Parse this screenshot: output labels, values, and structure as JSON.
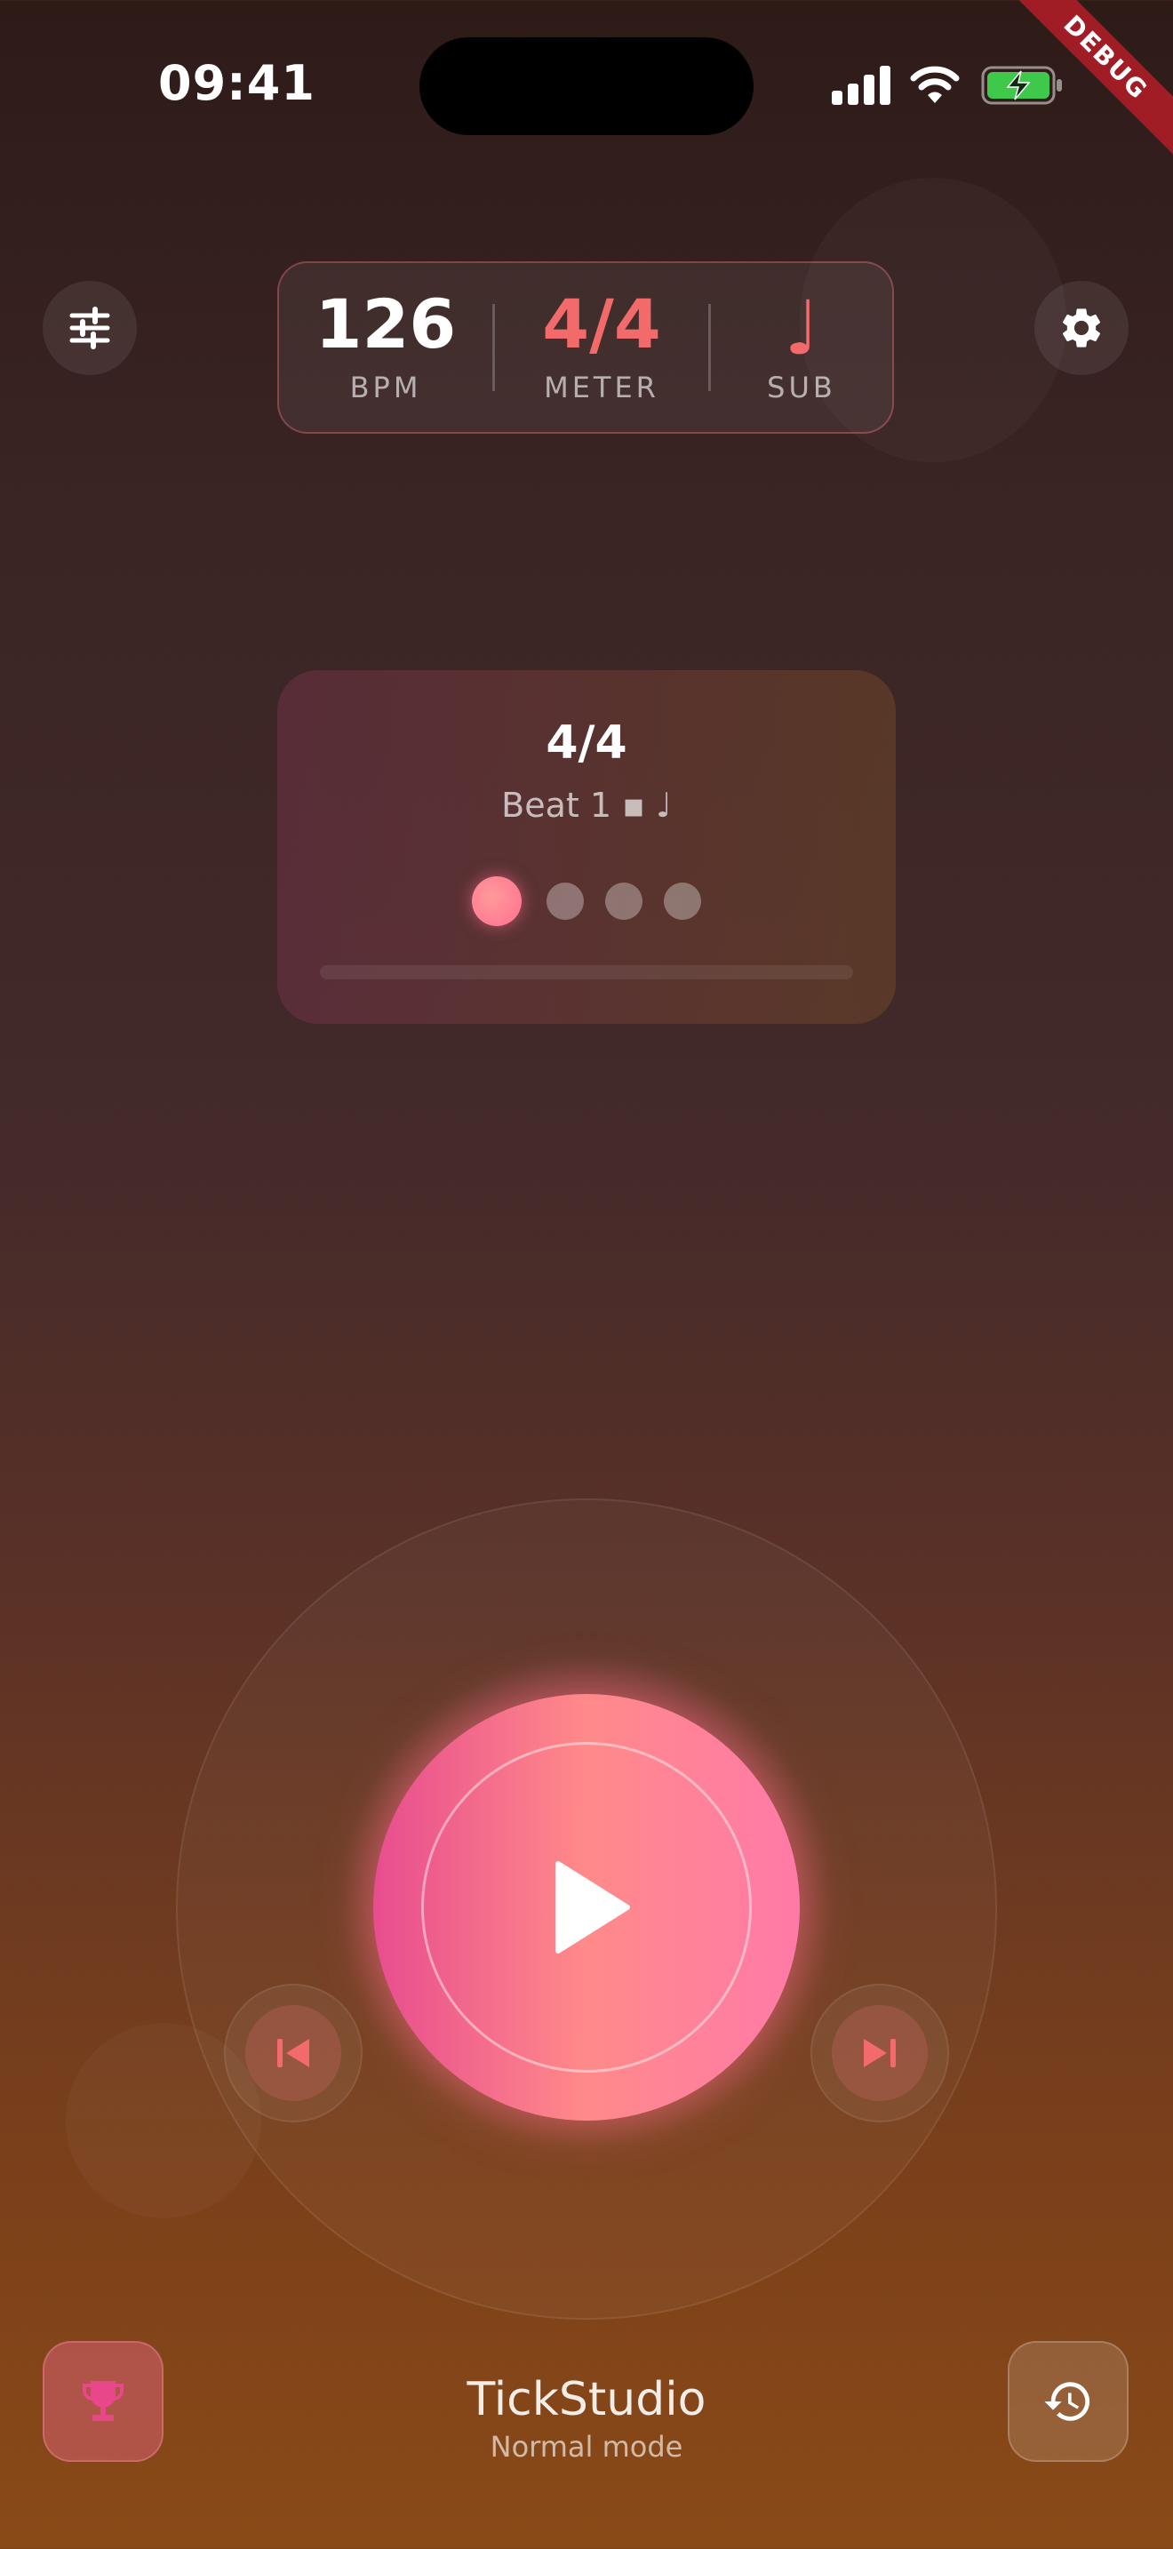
{
  "status_bar": {
    "time": "09:41"
  },
  "debug_banner": "DEBUG",
  "stats": {
    "bpm": {
      "value": "126",
      "label": "BPM"
    },
    "meter": {
      "value": "4/4",
      "label": "METER"
    },
    "sub": {
      "value": "♩",
      "label": "SUB"
    }
  },
  "beat_card": {
    "meter": "4/4",
    "beat_text": "Beat 1 ▪ ♩",
    "beats_total": 4,
    "active_beat": 1,
    "progress": 0.0
  },
  "footer": {
    "app_name": "TickStudio",
    "mode": "Normal mode"
  },
  "icons": {
    "left_top": "tune-icon",
    "right_top": "gear-icon",
    "play": "play-icon",
    "prev": "skip-previous-icon",
    "next": "skip-next-icon",
    "bottom_left": "trophy-icon",
    "bottom_right": "history-icon"
  },
  "colors": {
    "accent": "#f26a6a",
    "play_gradient_start": "#e84d8e",
    "play_gradient_mid": "#ff8a8a",
    "trophy": "#e8488a"
  }
}
